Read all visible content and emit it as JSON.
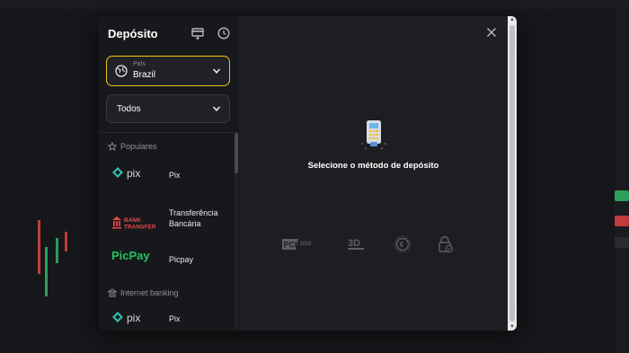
{
  "modal": {
    "title": "Depósito",
    "country_caption": "País",
    "country_value": "Brazil",
    "filter_value": "Todos",
    "prompt": "Selecione o método de depósito"
  },
  "sections": [
    {
      "title": "Populares",
      "icon": "star-icon",
      "items": [
        {
          "name": "Pix",
          "logo": "pix-logo"
        },
        {
          "name": "Transferência Bancária",
          "logo": "bank-transfer-logo"
        },
        {
          "name": "Picpay",
          "logo": "picpay-logo"
        }
      ]
    },
    {
      "title": "Internet banking",
      "icon": "bank-icon",
      "items": [
        {
          "name": "Pix",
          "logo": "pix-logo"
        }
      ]
    }
  ],
  "logos": {
    "pix": "pix",
    "bank_line1": "BANK",
    "bank_line2": "TRANSFER",
    "picpay": "PicPay"
  },
  "security_badges": [
    {
      "icon": "pci-dss-icon",
      "label": "PCI DSS"
    },
    {
      "icon": "3d-secure-icon",
      "label": "3D"
    },
    {
      "icon": "currency-icon",
      "label": "€"
    },
    {
      "icon": "lock-check-icon",
      "label": ""
    }
  ],
  "colors": {
    "accent": "#f0c419",
    "pix_teal": "#32bcad",
    "bank_red": "#e8474b",
    "picpay_green": "#21c25e"
  }
}
